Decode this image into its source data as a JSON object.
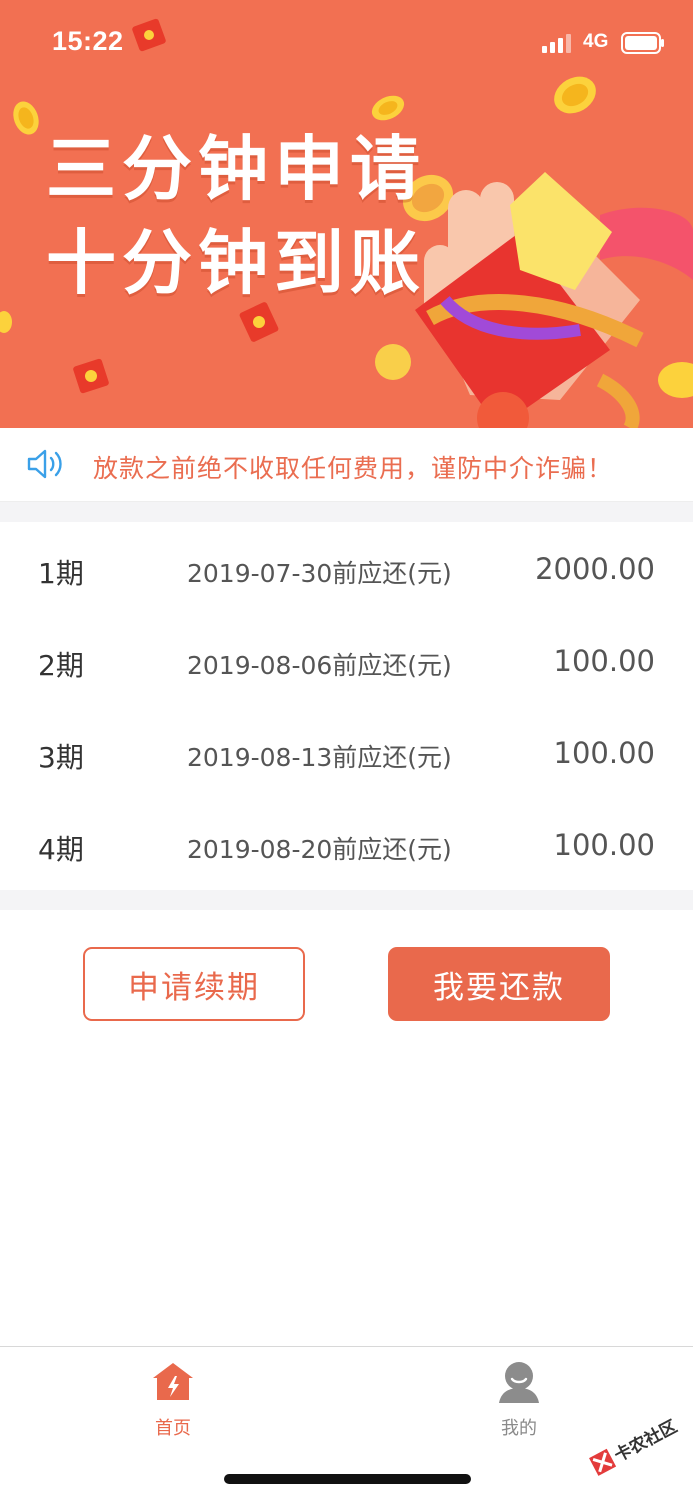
{
  "status_bar": {
    "time": "15:22",
    "network": "4G"
  },
  "banner": {
    "line1": "三分钟申请",
    "line2": "十分钟到账"
  },
  "notice": {
    "text": "放款之前绝不收取任何费用，谨防中介诈骗！"
  },
  "installments": [
    {
      "period": "1期",
      "due": "2019-07-30前应还(元)",
      "amount": "2000.00"
    },
    {
      "period": "2期",
      "due": "2019-08-06前应还(元)",
      "amount": "100.00"
    },
    {
      "period": "3期",
      "due": "2019-08-13前应还(元)",
      "amount": "100.00"
    },
    {
      "period": "4期",
      "due": "2019-08-20前应还(元)",
      "amount": "100.00"
    }
  ],
  "actions": {
    "renew_label": "申请续期",
    "repay_label": "我要还款"
  },
  "tabs": [
    {
      "label": "首页",
      "icon": "home-icon"
    },
    {
      "label": "我的",
      "icon": "profile-icon"
    }
  ],
  "watermark": {
    "text": "卡农社区"
  },
  "colors": {
    "accent": "#e9694c",
    "banner_bg": "#f27052",
    "notice_icon": "#3aa0e8"
  }
}
